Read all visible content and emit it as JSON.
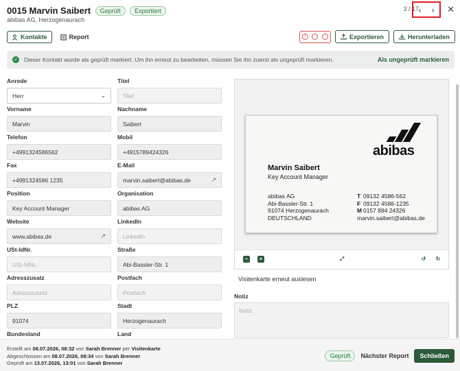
{
  "header": {
    "title": "0015 Marvin Saibert",
    "badges": [
      "Geprüft",
      "Exportiert"
    ],
    "subtitle": "abibas AG, Herzogenaurach",
    "pager": "3 / 17",
    "prev_icon": "chevron-left-icon",
    "next_icon": "chevron-right-icon",
    "close_icon": "close-icon"
  },
  "tabs": [
    {
      "label": "Kontakte",
      "icon": "person-icon",
      "active": true
    },
    {
      "label": "Report",
      "icon": "report-icon",
      "active": false
    }
  ],
  "toolbar": {
    "export_label": "Exportieren",
    "download_label": "Herunterladen"
  },
  "banner": {
    "message": "Dieser Kontakt wurde als geprüft markiert. Um ihn erneut zu bearbeiten, müssen Sie ihn zuerst als ungeprüft markieren.",
    "action": "Als ungeprüft markieren"
  },
  "form": {
    "anrede": {
      "label": "Anrede",
      "value": "Herr"
    },
    "titel": {
      "label": "Titel",
      "placeholder": "Titel"
    },
    "vorname": {
      "label": "Vorname",
      "value": "Marvin"
    },
    "nachname": {
      "label": "Nachname",
      "value": "Saibert"
    },
    "telefon": {
      "label": "Telefon",
      "value": "+4991324586562"
    },
    "mobil": {
      "label": "Mobil",
      "value": "+4915789424326"
    },
    "fax": {
      "label": "Fax",
      "value": "+4991324586 1235"
    },
    "email": {
      "label": "E-Mail",
      "value": "marvin.saibert@abibas.de"
    },
    "position": {
      "label": "Position",
      "value": "Key Account Manager"
    },
    "organisation": {
      "label": "Organisation",
      "value": "abibas AG"
    },
    "website": {
      "label": "Website",
      "value": "www.abibas.de"
    },
    "linkedin": {
      "label": "LinkedIn",
      "placeholder": "LinkedIn"
    },
    "ustid": {
      "label": "USt-IdNr.",
      "placeholder": "USt-IdNr."
    },
    "strasse": {
      "label": "Straße",
      "value": "Abi-Bassler-Str. 1"
    },
    "adresszusatz": {
      "label": "Adresszusatz",
      "placeholder": "Adresszusatz"
    },
    "postfach": {
      "label": "Postfach",
      "placeholder": "Postfach"
    },
    "plz": {
      "label": "PLZ",
      "value": "91074"
    },
    "stadt": {
      "label": "Stadt",
      "value": "Herzogenaurach"
    },
    "bundesland": {
      "label": "Bundesland"
    },
    "land": {
      "label": "Land"
    }
  },
  "card": {
    "brand": "abibas",
    "name": "Marvin Saibert",
    "role": "Key Account Manager",
    "address": [
      "abibas AG",
      "Abi-Bassler-Str. 1",
      "91074 Herzogenaurach",
      "DEUTSCHLAND"
    ],
    "contacts": [
      {
        "k": "T",
        "v": "09132 4586-562"
      },
      {
        "k": "F",
        "v": "09132 4586-1235"
      },
      {
        "k": "M",
        "v": "0157 894 24326"
      },
      {
        "k": "",
        "v": "marvin.saibert@abibas.de"
      }
    ]
  },
  "image_panel": {
    "reread_label": "Visitenkarte erneut auslesen"
  },
  "notes": {
    "label": "Notiz",
    "placeholder": "Notiz"
  },
  "footer": {
    "line1": {
      "pre": "Erstellt am",
      "date": "08.07.2026, 08:32",
      "mid": "von",
      "user": "Sarah Brenner",
      "suffix": "per",
      "source": "Visitenkarte"
    },
    "line2": {
      "pre": "Abgeschlossen am",
      "date": "08.07.2026, 08:34",
      "mid": "von",
      "user": "Sarah Brenner"
    },
    "line3": {
      "pre": "Geprüft am",
      "date": "13.07.2026, 13:01",
      "mid": "von",
      "user": "Sarah Brenner"
    },
    "status_badge": "Geprüft",
    "next_report": "Nächster Report",
    "close_label": "Schließen"
  },
  "colors": {
    "accent": "#2c5a3a",
    "success": "#2e8b48",
    "danger": "#d9534f",
    "highlight": "#e01b24"
  }
}
